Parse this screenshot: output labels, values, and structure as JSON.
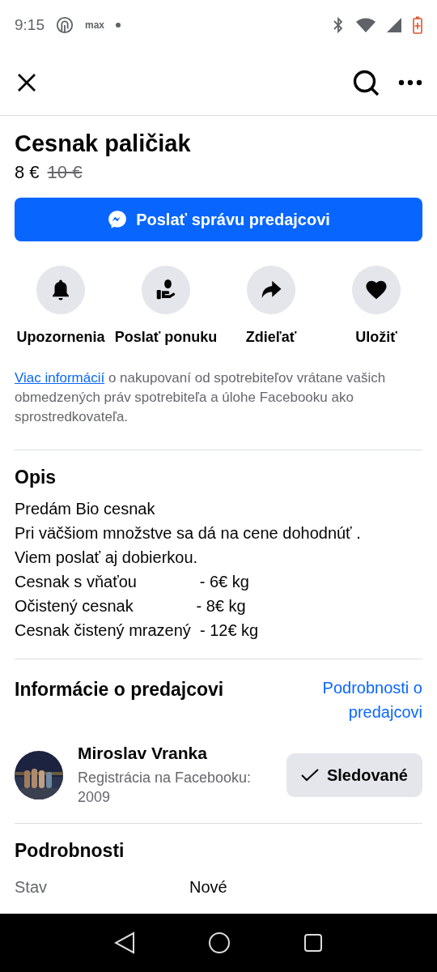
{
  "status_bar": {
    "time": "9:15",
    "app_label": "max"
  },
  "listing": {
    "title": "Cesnak paličiak",
    "price": "8 €",
    "old_price": "10 €"
  },
  "message_button": {
    "label": "Poslať správu predajcovi"
  },
  "actions": [
    {
      "kind": "bell",
      "label": "Upozornenia"
    },
    {
      "kind": "offer",
      "label": "Poslať ponuku"
    },
    {
      "kind": "share",
      "label": "Zdieľať"
    },
    {
      "kind": "save",
      "label": "Uložiť"
    }
  ],
  "info": {
    "link": "Viac informácií",
    "text": " o nakupovaní od spotrebiteľov vrátane vašich obmedzených práv spotrebiteľa a úlohe Facebooku ako sprostredkovateľa."
  },
  "description": {
    "heading": "Opis",
    "lines": [
      "Predám Bio cesnak",
      "Pri väčšiom množstve sa dá na cene dohodnúť .",
      "Viem poslať aj dobierkou.",
      "Cesnak s vňaťou              - 6€ kg",
      "Očistený cesnak              - 8€ kg",
      "Cesnak čistený mrazený  - 12€ kg"
    ]
  },
  "seller": {
    "heading": "Informácie o predajcovi",
    "details_link": "Podrobnosti o predajcovi",
    "name": "Miroslav Vranka",
    "registration": "Registrácia na Facebooku: 2009",
    "follow_button": "Sledované"
  },
  "details": {
    "heading": "Podrobnosti",
    "rows": [
      {
        "label": "Stav",
        "value": "Nové"
      }
    ]
  }
}
